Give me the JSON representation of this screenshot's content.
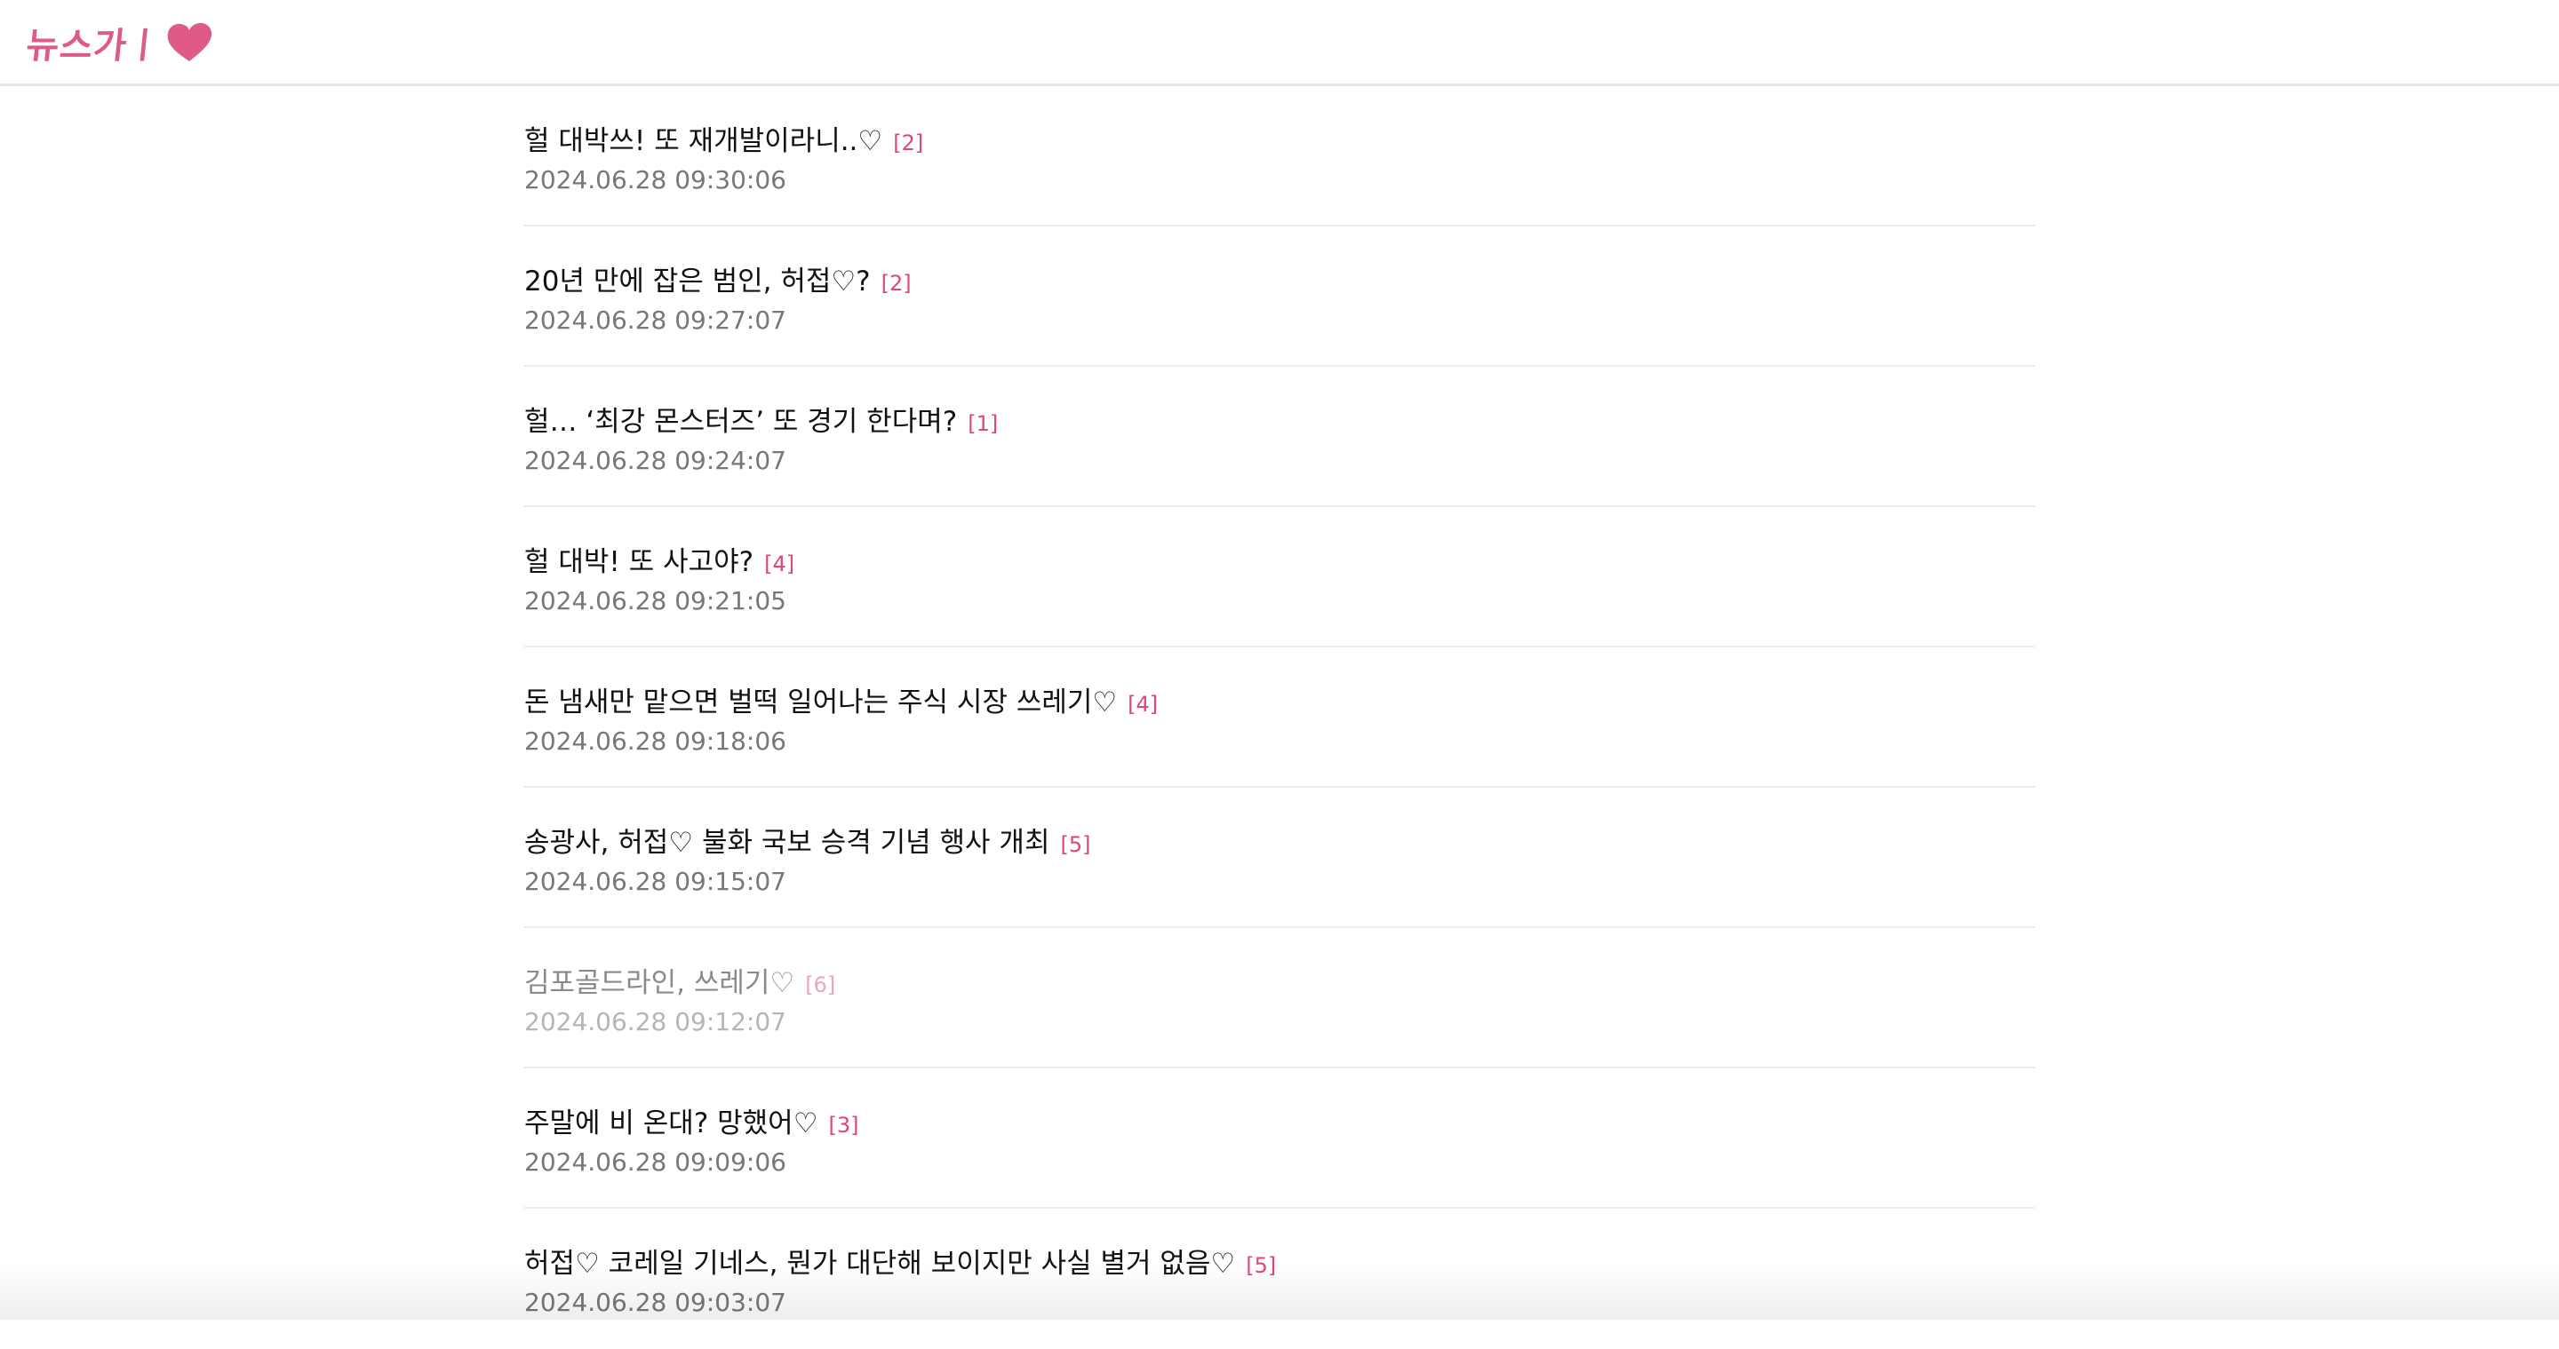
{
  "header": {
    "logo_text": "뉴스가ㅣ",
    "logo_icon": "heart-icon",
    "logo_color": "#e05a86"
  },
  "articles": [
    {
      "title": "헐 대박쓰! 또 재개발이라니..♡",
      "comments": "[2]",
      "date": "2024.06.28 09:30:06",
      "visited": false
    },
    {
      "title": "20년 만에 잡은 범인, 허접♡?",
      "comments": "[2]",
      "date": "2024.06.28 09:27:07",
      "visited": false
    },
    {
      "title": "헐… ‘최강 몬스터즈’ 또 경기 한다며?",
      "comments": "[1]",
      "date": "2024.06.28 09:24:07",
      "visited": false
    },
    {
      "title": "헐 대박! 또 사고야?",
      "comments": "[4]",
      "date": "2024.06.28 09:21:05",
      "visited": false
    },
    {
      "title": "돈 냄새만 맡으면 벌떡 일어나는 주식 시장 쓰레기♡",
      "comments": "[4]",
      "date": "2024.06.28 09:18:06",
      "visited": false
    },
    {
      "title": "송광사, 허접♡ 불화 국보 승격 기념 행사 개최",
      "comments": "[5]",
      "date": "2024.06.28 09:15:07",
      "visited": false
    },
    {
      "title": "김포골드라인, 쓰레기♡",
      "comments": "[6]",
      "date": "2024.06.28 09:12:07",
      "visited": true
    },
    {
      "title": "주말에 비 온대? 망했어♡",
      "comments": "[3]",
      "date": "2024.06.28 09:09:06",
      "visited": false
    },
    {
      "title": "허접♡ 코레일 기네스, 뭔가 대단해 보이지만 사실 별거 없음♡",
      "comments": "[5]",
      "date": "2024.06.28 09:03:07",
      "visited": false
    }
  ],
  "colors": {
    "accent": "#e0457b",
    "title": "#111111",
    "date": "#777777",
    "divider": "#ececec"
  }
}
